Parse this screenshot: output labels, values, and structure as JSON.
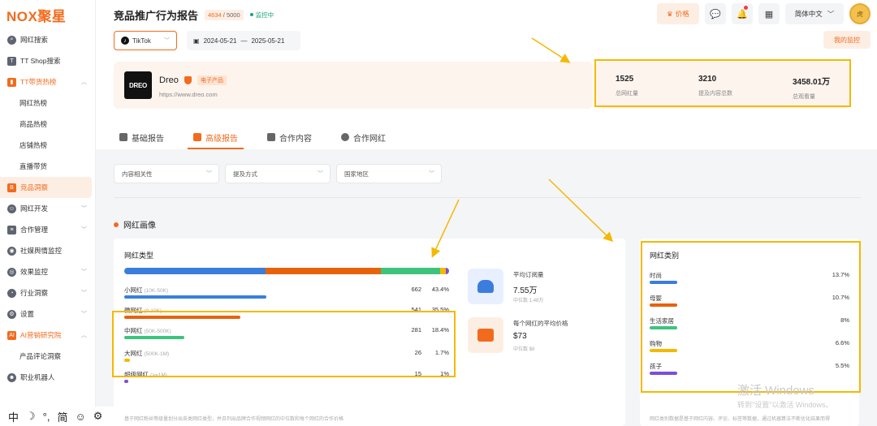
{
  "app": {
    "logo": "NOX聚星",
    "page_title": "竞品推广行为报告",
    "quota_used": "4634",
    "quota_total": "/ 5000",
    "monitor_status": "监控中"
  },
  "topbar": {
    "price_label": "价格",
    "language": "简体中文",
    "avatar_text": "虎"
  },
  "sidebar": {
    "items": [
      {
        "label": "网红搜索",
        "icon": "search-icon",
        "level": "top"
      },
      {
        "label": "TT Shop搜索",
        "icon": "shop-icon",
        "level": "top"
      },
      {
        "label": "TT带货热榜",
        "icon": "chart-icon",
        "level": "group-open"
      },
      {
        "label": "网红热榜",
        "level": "sub"
      },
      {
        "label": "商品热榜",
        "level": "sub"
      },
      {
        "label": "店铺热榜",
        "level": "sub"
      },
      {
        "label": "直播带货",
        "level": "sub"
      },
      {
        "label": "竞品洞察",
        "icon": "insight-icon",
        "level": "active"
      },
      {
        "label": "网红开发",
        "icon": "users-icon",
        "level": "group"
      },
      {
        "label": "合作管理",
        "icon": "doc-icon",
        "level": "group"
      },
      {
        "label": "社媒舆情监控",
        "icon": "monitor-icon",
        "level": "top"
      },
      {
        "label": "效果监控",
        "icon": "target-icon",
        "level": "group"
      },
      {
        "label": "行业洞察",
        "icon": "industry-icon",
        "level": "group"
      },
      {
        "label": "设置",
        "icon": "gear-icon",
        "level": "group"
      },
      {
        "label": "AI营销研究院",
        "icon": "ai-icon",
        "level": "group-orange"
      },
      {
        "label": "产品评论洞察",
        "level": "sub"
      },
      {
        "label": "职业机器人",
        "icon": "robot-icon",
        "level": "top"
      }
    ]
  },
  "ime": [
    "中",
    "☽",
    "°,",
    "简",
    "☺",
    "⚙"
  ],
  "filters": {
    "platform": "TikTok",
    "date_start": "2024-05-21",
    "date_sep": "—",
    "date_end": "2025-05-21",
    "my_monitor": "我的监控"
  },
  "brand": {
    "logo_text": "DREO",
    "name": "Dreo",
    "tag": "电子产品",
    "url": "https://www.dreo.com"
  },
  "stats": [
    {
      "value": "1525",
      "label": "总网红量"
    },
    {
      "value": "3210",
      "label": "提及内容总数"
    },
    {
      "value": "3458.01万",
      "label": "总观看量"
    }
  ],
  "tabs": [
    {
      "label": "基础报告",
      "active": false
    },
    {
      "label": "高级报告",
      "active": true
    },
    {
      "label": "合作内容",
      "active": false
    },
    {
      "label": "合作网红",
      "active": false
    }
  ],
  "sub_filters": [
    "内容相关性",
    "提及方式",
    "国家地区"
  ],
  "section": {
    "title": "网红画像"
  },
  "influencer_type": {
    "title": "网红类型",
    "stack_colors": [
      "#3b7ddd",
      "#e8620c",
      "#3cc47c",
      "#f5b800",
      "#7b4fd8"
    ],
    "rows": [
      {
        "name": "小网红",
        "range": "(10K-50K)",
        "count": "662",
        "pct": "43.4%",
        "share": 0.434,
        "color": "#3b7ddd"
      },
      {
        "name": "微网红",
        "range": "(0-10K)",
        "count": "541",
        "pct": "35.5%",
        "share": 0.355,
        "color": "#e8620c"
      },
      {
        "name": "中网红",
        "range": "(50K-500K)",
        "count": "281",
        "pct": "18.4%",
        "share": 0.184,
        "color": "#3cc47c"
      },
      {
        "name": "大网红",
        "range": "(500K-1M)",
        "count": "26",
        "pct": "1.7%",
        "share": 0.017,
        "color": "#f5b800"
      },
      {
        "name": "超级网红",
        "range": "(>=1M)",
        "count": "15",
        "pct": "1%",
        "share": 0.01,
        "color": "#7b4fd8"
      }
    ],
    "footnote": "基于网红粉丝等级量划分出各类网红类型，并且列出品牌合作视频网红的中位数和每个网红的合作价格"
  },
  "metrics": [
    {
      "label": "平均订阅量",
      "value": "7.55万",
      "sub": "中位数 1.48万",
      "icon": "users-icon",
      "color": "#3b7ddd"
    },
    {
      "label": "每个网红的平均价格",
      "value": "$73",
      "sub": "中位数 $8",
      "icon": "money-icon",
      "color": "#f26b1d"
    }
  ],
  "influencer_category": {
    "title": "网红类别",
    "rows": [
      {
        "name": "时尚",
        "pct": "13.7%",
        "color": "#3b7ddd"
      },
      {
        "name": "母婴",
        "pct": "10.7%",
        "color": "#e8620c"
      },
      {
        "name": "生活家居",
        "pct": "8%",
        "color": "#3cc47c"
      },
      {
        "name": "购物",
        "pct": "6.6%",
        "color": "#f5b800"
      },
      {
        "name": "孩子",
        "pct": "5.5%",
        "color": "#7b4fd8"
      }
    ],
    "footnote": "网红类别数据是基于网红内容、评论、标签等数据，通过机器算法不断优化结果而得"
  },
  "watermark": {
    "line1": "激活 Windows",
    "line2": "转到\"设置\"以激活 Windows。"
  },
  "colors": {
    "accent": "#f26b1d",
    "highlight": "#f5b800",
    "status_green": "#1aa36f"
  }
}
